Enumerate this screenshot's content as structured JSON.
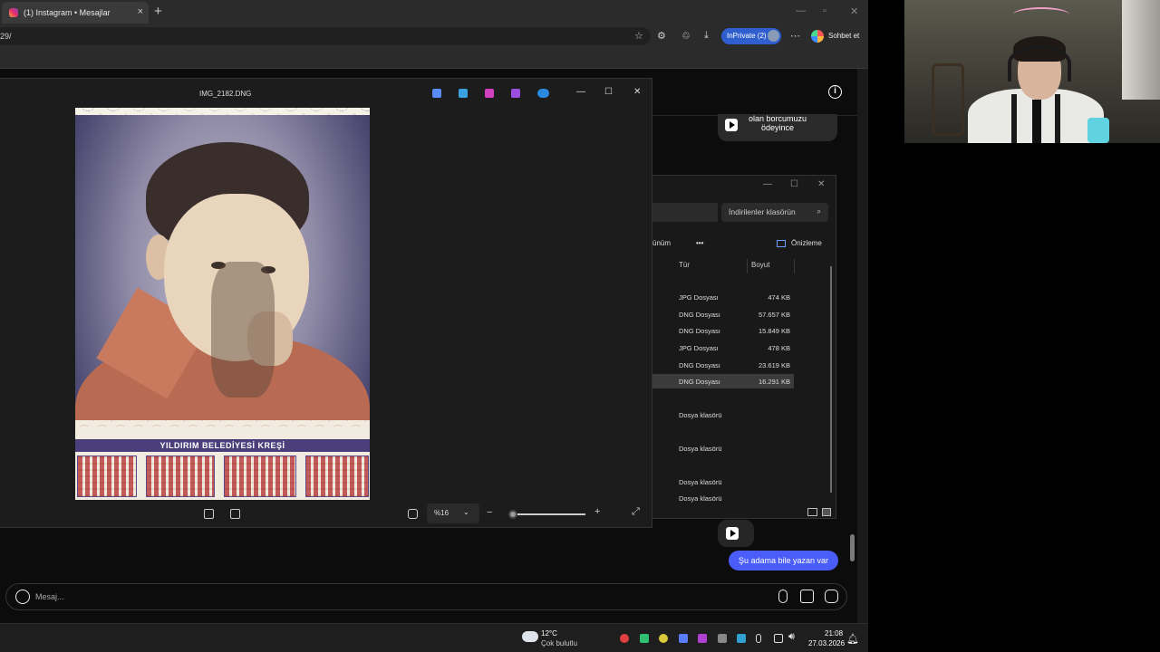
{
  "browser": {
    "tab_title": "(1) Instagram • Mesajlar",
    "url": "29/",
    "inprivate_label": "InPrivate (2)",
    "chat_label": "Sohbet et",
    "new_tab": "+",
    "close_tab": "×",
    "more": "⋯"
  },
  "instagram": {
    "reel_text": "olan borcumuzu ödeyince",
    "message": "Şu adama bile yazan var",
    "composer_placeholder": "Mesaj...",
    "info_glyph": "i"
  },
  "photos": {
    "title": "IMG_2182.DNG",
    "calendar_title": "YILDIRIM BELEDİYESİ KREŞİ",
    "zoom": "%16",
    "minimize": "—",
    "maximize": "☐",
    "close": "✕"
  },
  "explorer": {
    "search_placeholder": "İndirilenler klasörün",
    "view_label": "ünüm",
    "preview_label": "Önizleme",
    "col_type": "Tür",
    "col_size": "Boyut",
    "rows": [
      {
        "type": "JPG Dosyası",
        "size": "474 KB"
      },
      {
        "type": "DNG Dosyası",
        "size": "57.657 KB"
      },
      {
        "type": "DNG Dosyası",
        "size": "15.849 KB"
      },
      {
        "type": "JPG Dosyası",
        "size": "478 KB"
      },
      {
        "type": "DNG Dosyası",
        "size": "23.619 KB"
      },
      {
        "type": "DNG Dosyası",
        "size": "16.291 KB"
      },
      {
        "type": "Dosya klasörü",
        "size": ""
      },
      {
        "type": "Dosya klasörü",
        "size": ""
      },
      {
        "type": "Dosya klasörü",
        "size": ""
      },
      {
        "type": "Dosya klasörü",
        "size": ""
      }
    ]
  },
  "taskbar": {
    "temp": "12°C",
    "weather": "Çok bulutlu",
    "time": "21:08",
    "date": "27.03.2026"
  },
  "colors": {
    "message_bubble": "#4a5df9",
    "inprivate": "#2f5fcf"
  }
}
